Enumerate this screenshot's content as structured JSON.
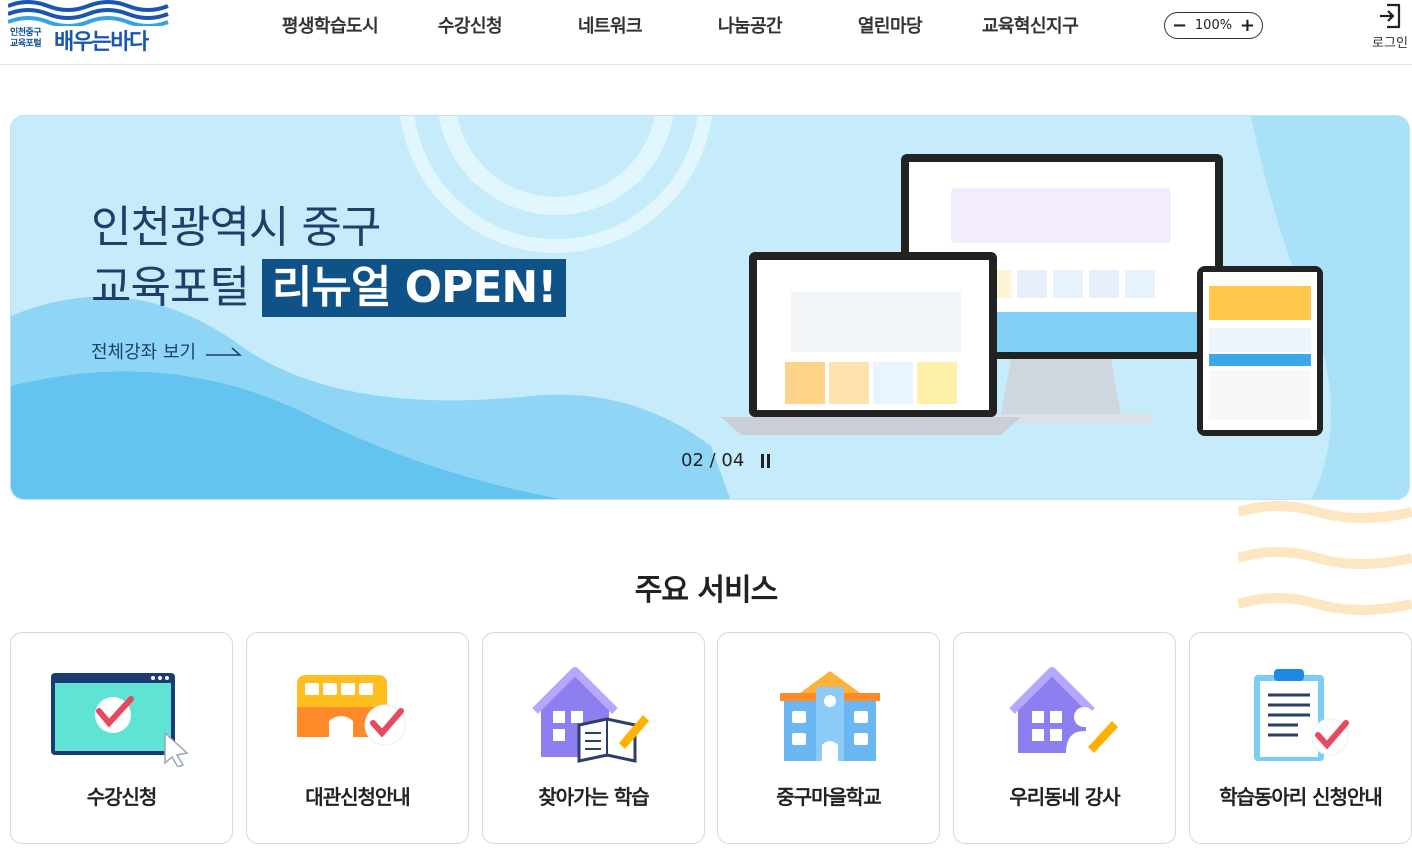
{
  "header": {
    "logo_small_line1": "인천중구",
    "logo_small_line2": "교육포털",
    "logo_main": "배우는바다",
    "nav": [
      "평생학습도시",
      "수강신청",
      "네트워크",
      "나눔공간",
      "열린마당",
      "교육혁신지구"
    ],
    "zoom_minus": "−",
    "zoom_value": "100%",
    "zoom_plus": "+",
    "login_label": "로그인",
    "icons": {
      "login": "login-icon",
      "logo": "wave-logo-icon"
    }
  },
  "banner": {
    "title_line1": "인천광역시 중구",
    "title_line2_prefix": "교육포털",
    "title_line2_highlight": "리뉴얼 OPEN!",
    "link_label": "전체강좌 보기",
    "pager": "02 / 04",
    "colors": {
      "background": "#c6ecfb",
      "highlight": "#0f5288"
    }
  },
  "services": {
    "title": "주요 서비스",
    "items": [
      {
        "label": "수강신청",
        "icon": "course-application-icon"
      },
      {
        "label": "대관신청안내",
        "icon": "facility-rental-icon"
      },
      {
        "label": "찾아가는 학습",
        "icon": "visiting-learning-icon"
      },
      {
        "label": "중구마을학교",
        "icon": "village-school-icon"
      },
      {
        "label": "우리동네 강사",
        "icon": "local-instructor-icon"
      },
      {
        "label": "학습동아리 신청안내",
        "icon": "study-club-icon"
      }
    ]
  }
}
